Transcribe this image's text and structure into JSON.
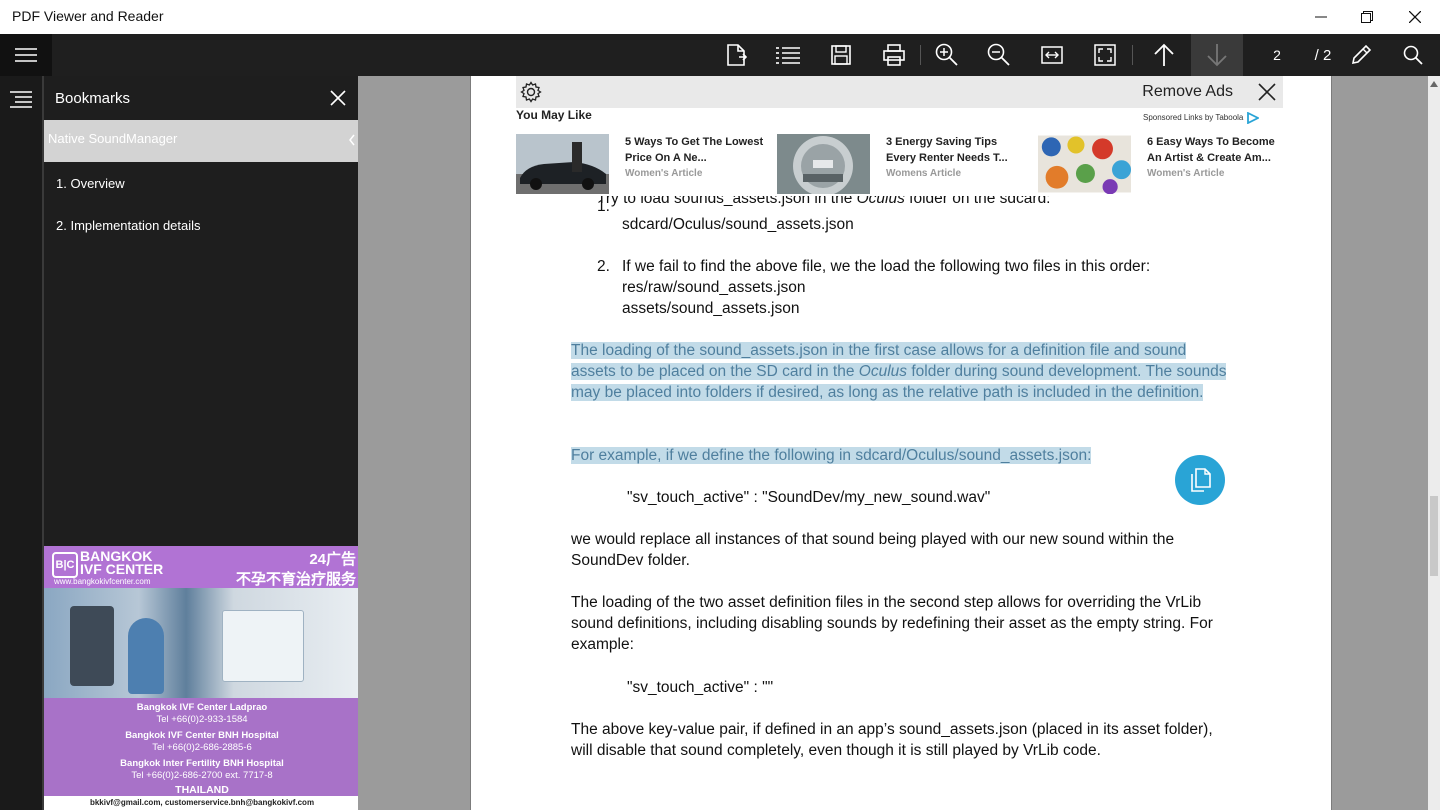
{
  "window": {
    "title": "PDF Viewer and Reader"
  },
  "toolbar": {
    "page_current": "2",
    "page_total": "/ 2"
  },
  "bookmarks": {
    "title": "Bookmarks",
    "selected": "Native SoundManager",
    "items": [
      "1. Overview",
      "2. Implementation details"
    ]
  },
  "side_ad": {
    "logo": "B|C",
    "brand_line1": "BANGKOK",
    "brand_line2": "IVF CENTER",
    "site": "www.bangkokivfcenter.com",
    "tag": "24广告",
    "slogan": "不孕不育治疗服务",
    "lines": [
      "Bangkok IVF Center Ladprao",
      "Tel +66(0)2-933-1584",
      "Bangkok IVF Center BNH Hospital",
      "Tel +66(0)2-686-2885-6",
      "Bangkok Inter Fertility BNH Hospital",
      "Tel +66(0)2-686-2700 ext. 7717-8",
      "THAILAND"
    ],
    "emails": "bkkivf@gmail.com, customerservice.bnh@bangkokivf.com"
  },
  "doc_ad": {
    "remove_label": "Remove Ads",
    "heading": "You May Like",
    "sponsored": "Sponsored Links by Taboola",
    "cards": [
      {
        "title": "5 Ways To Get The Lowest Price On A Ne...",
        "source": "Women's Article"
      },
      {
        "title": "3 Energy Saving Tips Every Renter Needs T...",
        "source": "Womens Article"
      },
      {
        "title": "6 Easy Ways To Become An Artist & Create Am...",
        "source": "Women's Article"
      }
    ]
  },
  "doc": {
    "item1_num": "1.",
    "item1_pre": "Try to load sounds_assets.json in the ",
    "item1_em": "Oculus",
    "item1_post": " folder on the sdcard:",
    "item1_path": "sdcard/Oculus/sound_assets.json",
    "item2_num": "2.",
    "item2_text": "If we fail to find the above file, we the load the following two files in this order:",
    "item2_path1": "res/raw/sound_assets.json",
    "item2_path2": "assets/sound_assets.json",
    "hl1_pre": "The loading of the sound_assets.json in the first case allows for a definition file and sound assets to be placed on the SD card in the ",
    "hl1_em": "Oculus",
    "hl1_post": " folder during sound development. The sounds may be placed into folders if desired, as long as the relative path is included in the definition.  ",
    "hl2": "For example, if we define the following in sdcard/Oculus/sound_assets.json: ",
    "code1": "\"sv_touch_active\" : \"SoundDev/my_new_sound.wav\"",
    "para2": "we would replace all instances of that sound being played with our new sound within the SoundDev folder.",
    "para3": "The loading of the two asset definition files in the second step allows for overriding the VrLib sound definitions, including disabling sounds by redefining their asset as the empty string. For example:",
    "code2": "\"sv_touch_active\" : \"\"",
    "para4": "The above key-value pair, if defined in an app’s sound_assets.json (placed in its asset folder), will disable that sound completely, even though it is still played by VrLib code."
  },
  "colors": {
    "toolbar": "#1f1f1f",
    "highlight": "#c2dbe8",
    "highlight_text": "#4f7f9e",
    "fab": "#29a4d6",
    "ad_purple": "#b173d4"
  }
}
